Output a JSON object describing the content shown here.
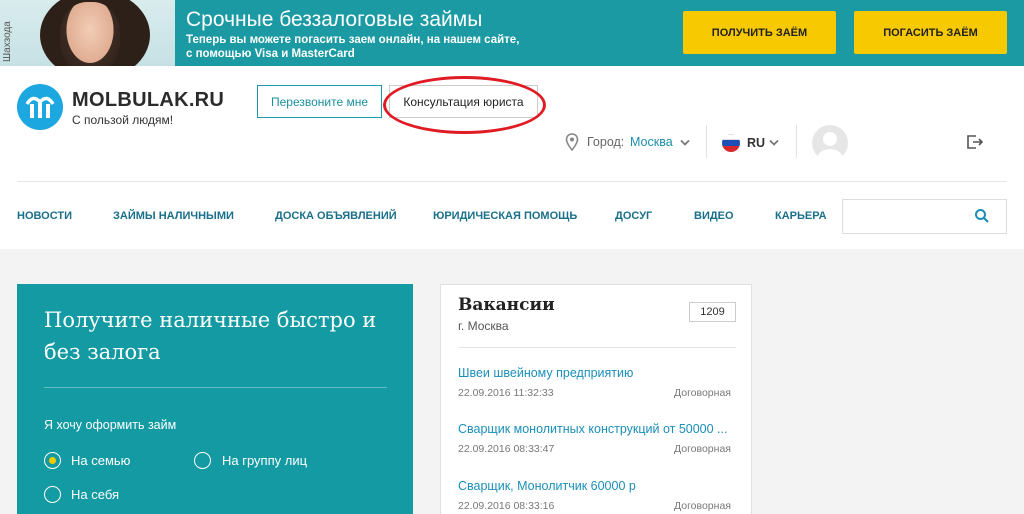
{
  "banner": {
    "vertical_label": "Шахзода",
    "title": "Срочные беззалоговые займы",
    "subtitle": "Теперь вы можете погасить заем онлайн, на нашем сайте, с помощью Visa и MasterCard",
    "get_loan_label": "ПОЛУЧИТЬ ЗАЁМ",
    "pay_loan_label": "ПОГАСИТЬ ЗАЁМ"
  },
  "logo": {
    "name": "MOLBULAK.RU",
    "tagline": "С пользой людям!"
  },
  "header": {
    "callback_label": "Перезвоните мне",
    "lawyer_label": "Консультация юриста",
    "city_label": "Город:",
    "city_value": "Москва",
    "lang": "RU"
  },
  "nav": {
    "items": [
      "НОВОСТИ",
      "ЗАЙМЫ НАЛИЧНЫМИ",
      "ДОСКА ОБЪЯВЛЕНИЙ",
      "ЮРИДИЧЕСКАЯ ПОМОЩЬ",
      "ДОСУГ",
      "ВИДЕО",
      "КАРЬЕРА"
    ],
    "search_placeholder": ""
  },
  "loan": {
    "title": "Получите наличные быстро и без залога",
    "label": "Я хочу оформить займ",
    "options": [
      "На семью",
      "На группу лиц",
      "На себя"
    ],
    "selected": 0
  },
  "vacancies": {
    "title": "Вакансии",
    "city": "г. Москва",
    "count": "1209",
    "jobs": [
      {
        "title": "Швеи швейному предприятию",
        "date": "22.09.2016 11:32:33",
        "pay": "Договорная"
      },
      {
        "title": "Сварщик монолитных конструкций от 50000 ...",
        "date": "22.09.2016 08:33:47",
        "pay": "Договорная"
      },
      {
        "title": "Сварщик, Монолитчик 60000 р",
        "date": "22.09.2016 08:33:16",
        "pay": "Договорная"
      }
    ]
  },
  "colors": {
    "teal": "#1b9aa3",
    "yellow": "#f7c900",
    "link": "#1a8fb8",
    "highlight": "#e01b24"
  },
  "icons": [
    "location-pin-icon",
    "chevron-down-icon",
    "russia-flag-icon",
    "avatar",
    "logout-icon",
    "search-icon"
  ]
}
